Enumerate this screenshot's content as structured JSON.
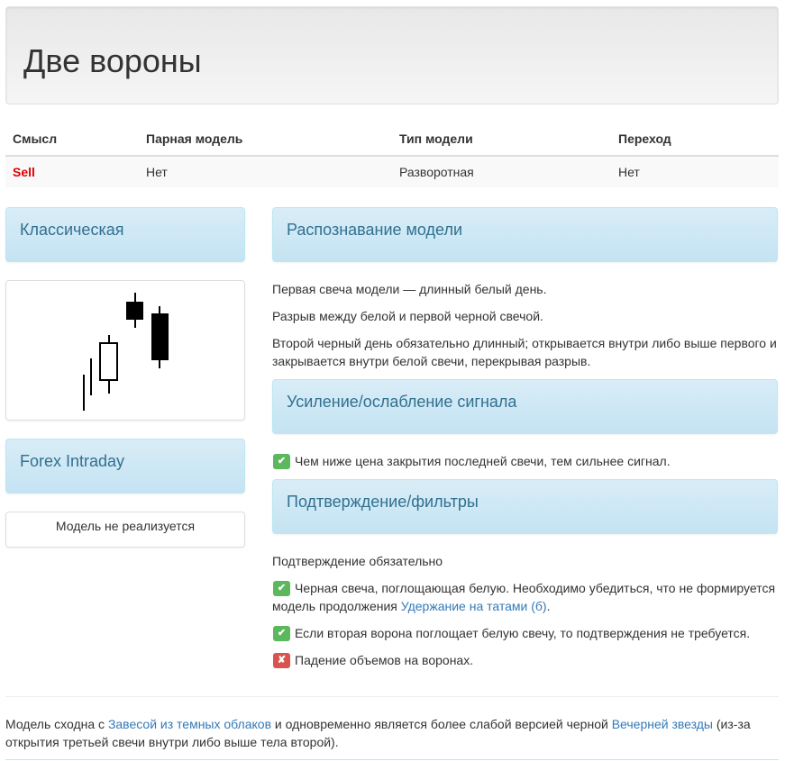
{
  "title": "Две вороны",
  "table": {
    "headers": [
      "Смысл",
      "Парная модель",
      "Тип модели",
      "Переход"
    ],
    "row": [
      "Sell",
      "Нет",
      "Разворотная",
      "Нет"
    ]
  },
  "left": {
    "classic_heading": "Классическая",
    "forex_heading": "Forex Intraday",
    "forex_note": "Модель не реализуется"
  },
  "recognition": {
    "heading": "Распознавание модели",
    "lines": [
      "Первая свеча модели — длинный белый день.",
      "Разрыв между белой и первой черной свечой.",
      "Второй черный день обязательно длинный; открывается внутри либо выше первого и закрывается внутри белой свечи, перекрывая разрыв."
    ]
  },
  "signal": {
    "heading": "Усиление/ослабление сигнала",
    "items": [
      {
        "status": "ok",
        "text": "Чем ниже цена закрытия последней свечи, тем сильнее сигнал."
      }
    ]
  },
  "confirm": {
    "heading": "Подтверждение/фильтры",
    "intro": "Подтверждение обязательно",
    "item1_text": "Черная свеча, поглощающая белую. Необходимо убедиться, что не формируется модель продолжения ",
    "item1_link": "Удержание на татами (б)",
    "item1_end": ".",
    "item2_text": "Если вторая ворона поглощает белую свечу, то подтверждения не требуется.",
    "item3_text": "Падение объемов на воронах."
  },
  "footer": {
    "t1": "Модель сходна с ",
    "link1": "Завесой из темных облаков",
    "t2": " и одновременно является более слабой версией черной ",
    "link2": "Вечерней звезды",
    "t3": " (из-за открытия третьей свечи внутри либо выше тела второй)."
  },
  "icons": {
    "check": "check-icon",
    "cross": "cross-icon"
  },
  "colors": {
    "sell": "#e00000",
    "panel_heading_text": "#31708f",
    "link": "#337ab7",
    "check_ok": "#5cb85c",
    "check_no": "#d9534f"
  }
}
